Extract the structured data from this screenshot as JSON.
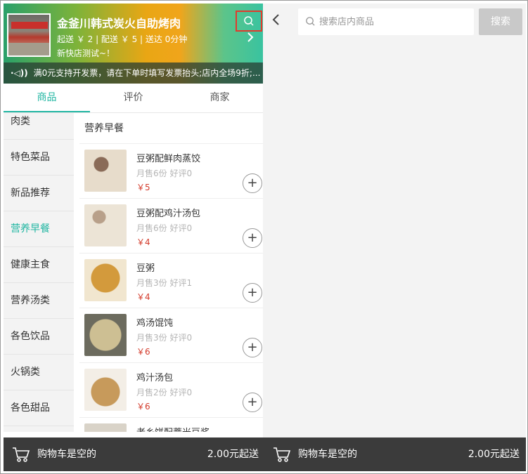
{
  "shop": {
    "name": "金釜川韩式炭火自助烤肉",
    "meta": "起送 ￥ 2 | 配送 ￥ 5 | 送达 0分钟",
    "subtitle": "新快店测试~！",
    "notice": "满0元支持开发票，请在下单时填写发票抬头;店内全场9折;..."
  },
  "tabs": [
    {
      "label": "商品",
      "active": true
    },
    {
      "label": "评价",
      "active": false
    },
    {
      "label": "商家",
      "active": false
    }
  ],
  "categories": [
    {
      "label": "肉类"
    },
    {
      "label": "特色菜品"
    },
    {
      "label": "新品推荐"
    },
    {
      "label": "营养早餐",
      "active": true
    },
    {
      "label": "健康主食"
    },
    {
      "label": "营养汤类"
    },
    {
      "label": "各色饮品"
    },
    {
      "label": "火锅类"
    },
    {
      "label": "各色甜品"
    }
  ],
  "section_title": "营养早餐",
  "items": [
    {
      "name": "豆粥配鲜肉蒸饺",
      "sales": "月售6份 好评0",
      "price": "￥5"
    },
    {
      "name": "豆粥配鸡汁汤包",
      "sales": "月售6份 好评0",
      "price": "￥4"
    },
    {
      "name": "豆粥",
      "sales": "月售3份 好评1",
      "price": "￥4"
    },
    {
      "name": "鸡汤馄饨",
      "sales": "月售3份 好评0",
      "price": "￥6"
    },
    {
      "name": "鸡汁汤包",
      "sales": "月售2份 好评0",
      "price": "￥6"
    },
    {
      "name": "老乡饼配薏米豆浆",
      "sales": "",
      "price": ""
    }
  ],
  "cart": {
    "left": {
      "status": "购物车是空的",
      "minimum": "2.00元起送"
    },
    "right": {
      "status": "购物车是空的",
      "minimum": "2.00元起送"
    }
  },
  "search": {
    "placeholder": "搜索店内商品",
    "button": "搜索"
  },
  "icons": {
    "search": "search-icon",
    "back": "chevron-left-icon",
    "forward": "chevron-right-icon",
    "cart": "cart-icon",
    "add": "plus-icon",
    "speaker": "speaker-icon"
  },
  "colors": {
    "accent": "#21b6a2",
    "price": "#d33a2a",
    "cartbar": "#3b3b3b",
    "highlight_border": "#e23a2d"
  }
}
